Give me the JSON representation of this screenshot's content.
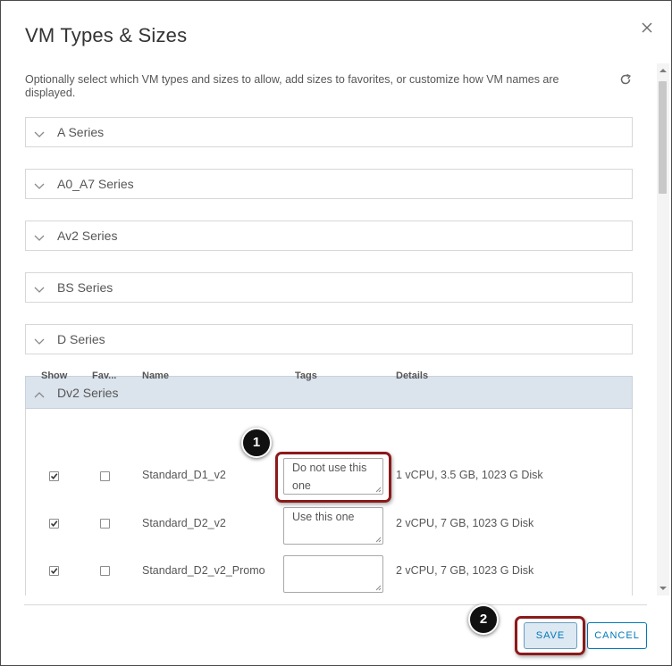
{
  "dialog": {
    "title": "VM Types & Sizes",
    "description": "Optionally select which VM types and sizes to allow, add sizes to favorites, or customize how VM names are displayed."
  },
  "series": [
    {
      "label": "A Series",
      "expanded": false
    },
    {
      "label": "A0_A7 Series",
      "expanded": false
    },
    {
      "label": "Av2 Series",
      "expanded": false
    },
    {
      "label": "BS Series",
      "expanded": false
    },
    {
      "label": "D Series",
      "expanded": false
    },
    {
      "label": "Dv2 Series",
      "expanded": true
    }
  ],
  "table": {
    "columns": [
      "Show",
      "Fav...",
      "Name",
      "Tags",
      "Details"
    ],
    "rows": [
      {
        "show": true,
        "fav": false,
        "name": "Standard_D1_v2",
        "tags": "Do not use this one",
        "details": "1 vCPU, 3.5 GB, 1023 G Disk"
      },
      {
        "show": true,
        "fav": false,
        "name": "Standard_D2_v2",
        "tags": "Use this one",
        "details": "2 vCPU, 7 GB, 1023 G Disk"
      },
      {
        "show": true,
        "fav": false,
        "name": "Standard_D2_v2_Promo",
        "tags": "",
        "details": "2 vCPU, 7 GB, 1023 G Disk"
      }
    ]
  },
  "footer": {
    "save_label": "SAVE",
    "cancel_label": "CANCEL"
  },
  "callouts": [
    "1",
    "2"
  ],
  "colors": {
    "accent": "#0079b8",
    "expanded_header": "#dbe3ec",
    "highlight": "#8b1a1a"
  }
}
